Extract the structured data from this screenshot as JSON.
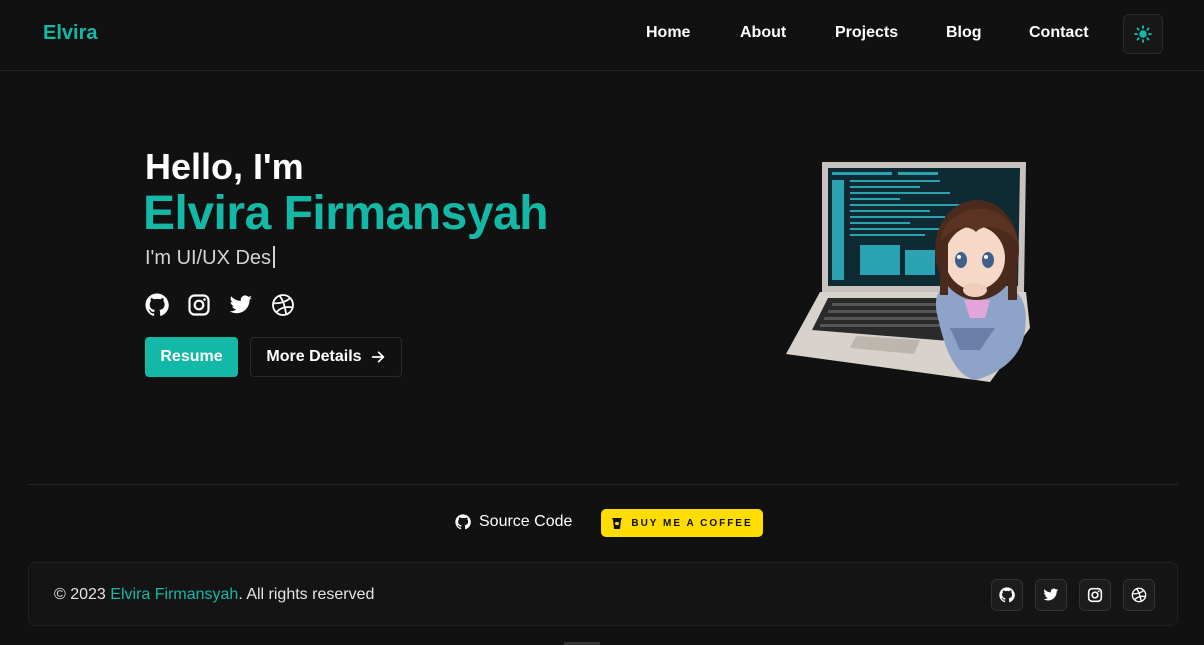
{
  "header": {
    "logo": "Elvira",
    "nav": [
      "Home",
      "About",
      "Projects",
      "Blog",
      "Contact"
    ],
    "theme_toggle_icon": "sun-icon"
  },
  "hero": {
    "greeting": "Hello, I'm",
    "name": "Elvira Firmansyah",
    "typed_text": "I'm UI/UX Des",
    "social_icons": [
      "github-icon",
      "instagram-icon",
      "twitter-icon",
      "dribbble-icon"
    ],
    "resume_label": "Resume",
    "more_label": "More Details"
  },
  "links": {
    "source_label": "Source Code",
    "coffee_label": "BUY ME A COFFEE"
  },
  "footer": {
    "copyright_prefix": "© 2023 ",
    "copyright_name": "Elvira Firmansyah",
    "copyright_suffix": ". All rights reserved",
    "social_icons": [
      "github-icon",
      "twitter-icon",
      "instagram-icon",
      "dribbble-icon"
    ]
  },
  "colors": {
    "accent": "#14b8a6",
    "background": "#111111",
    "coffee": "#ffdd00"
  }
}
